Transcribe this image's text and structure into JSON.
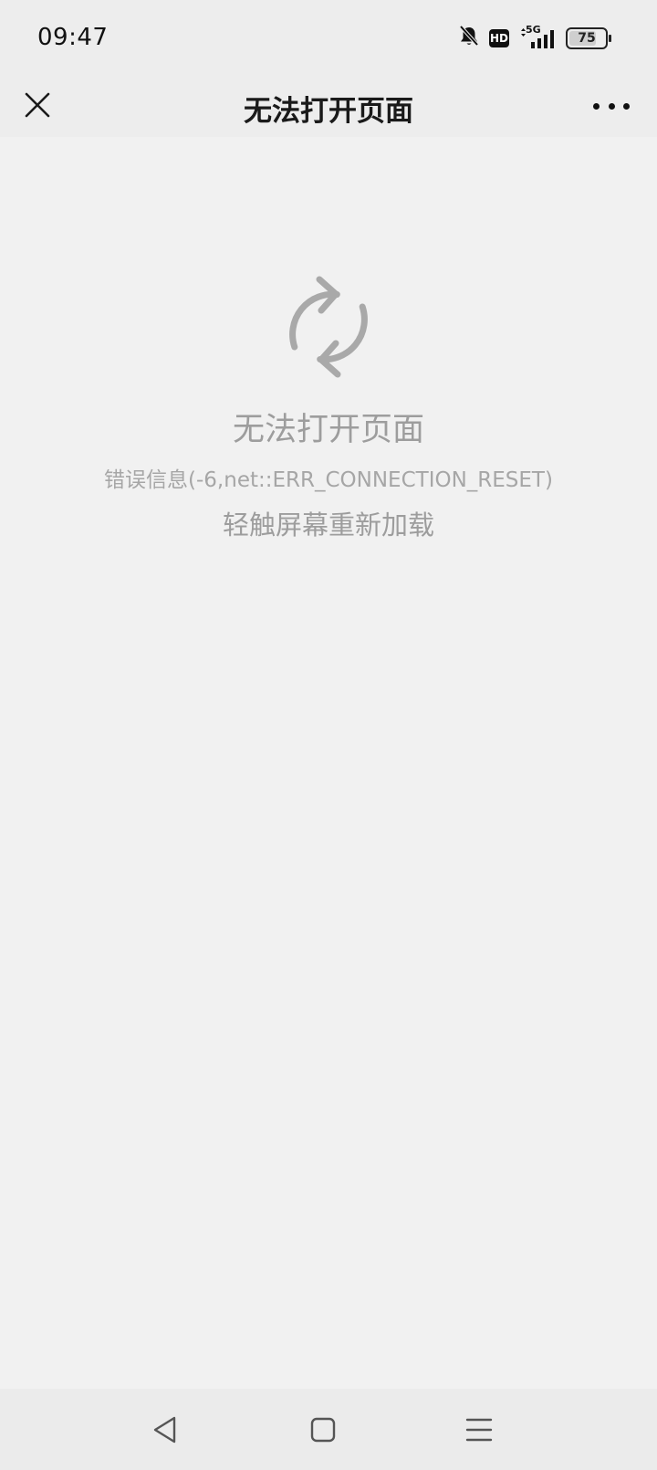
{
  "status_bar": {
    "time": "09:47",
    "network_label": "5G",
    "hd_label": "HD",
    "battery_level": "75",
    "icons": [
      "bell-off-icon",
      "hd-icon",
      "signal-5g-icon",
      "battery-icon"
    ]
  },
  "nav_bar": {
    "title": "无法打开页面",
    "close_icon": "close-icon",
    "more_icon": "more-icon"
  },
  "error": {
    "title": "无法打开页面",
    "detail": "错误信息(-6,net::ERR_CONNECTION_RESET)",
    "hint": "轻触屏幕重新加载",
    "icon": "refresh-icon"
  },
  "system_nav": {
    "back_icon": "back-icon",
    "home_icon": "home-icon",
    "recents_icon": "recents-icon"
  },
  "colors": {
    "background": "#f1f1f1",
    "bar_background": "#ededed",
    "muted_text": "#9d9d9d"
  }
}
